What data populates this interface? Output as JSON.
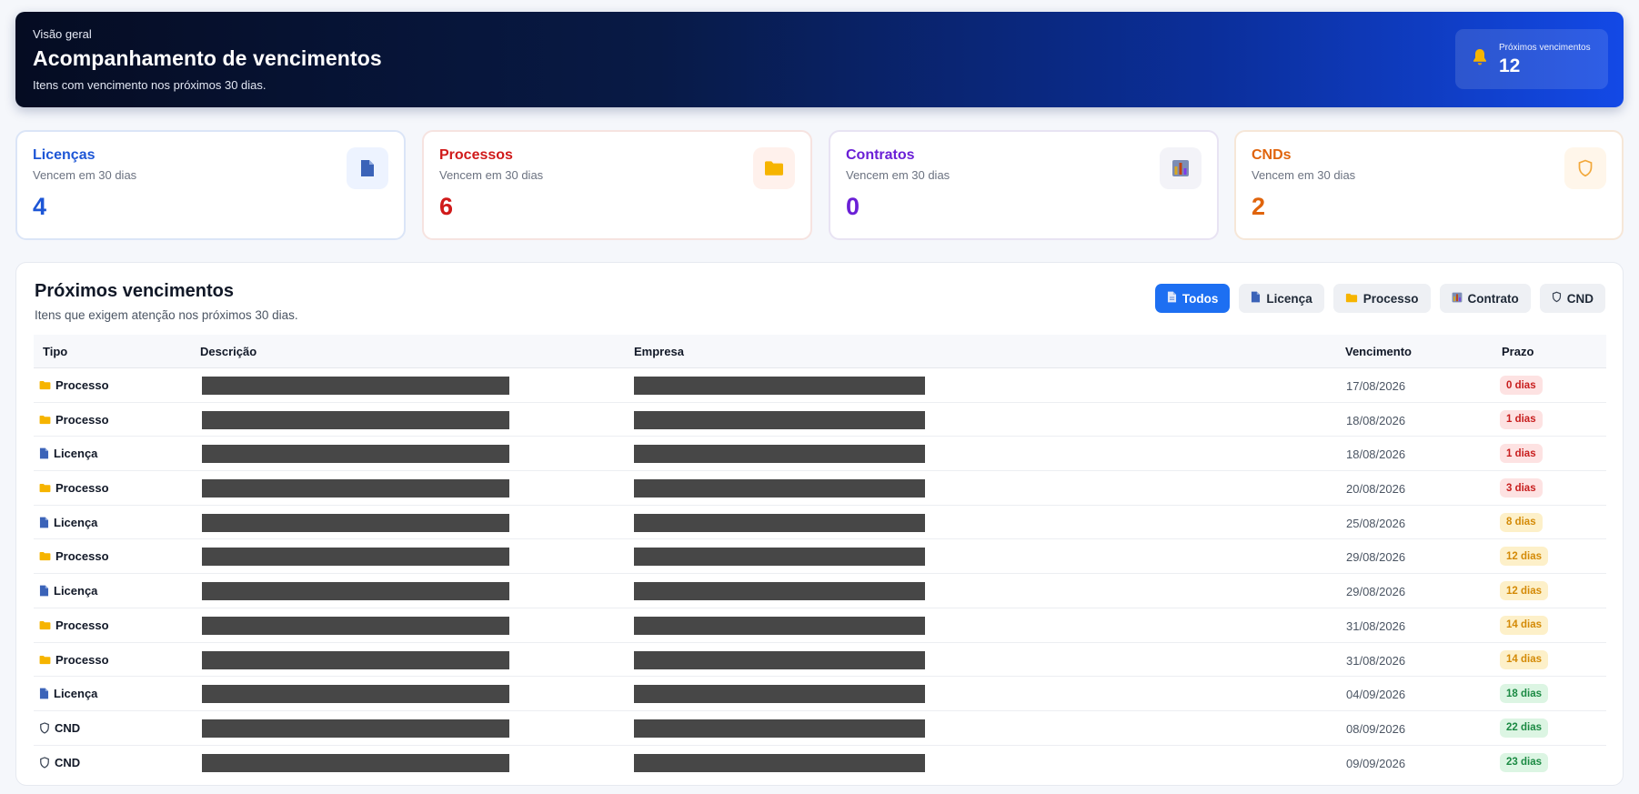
{
  "hero": {
    "eyebrow": "Visão geral",
    "title": "Acompanhamento de vencimentos",
    "subtitle": "Itens com vencimento nos próximos 30 dias.",
    "counter_label": "Próximos vencimentos",
    "counter_value": "12"
  },
  "cards": {
    "licencas": {
      "title": "Licenças",
      "subtitle": "Vencem em 30 dias",
      "value": "4",
      "icon": "document-icon"
    },
    "processos": {
      "title": "Processos",
      "subtitle": "Vencem em 30 dias",
      "value": "6",
      "icon": "folder-icon"
    },
    "contratos": {
      "title": "Contratos",
      "subtitle": "Vencem em 30 dias",
      "value": "0",
      "icon": "chart-icon"
    },
    "cnds": {
      "title": "CNDs",
      "subtitle": "Vencem em 30 dias",
      "value": "2",
      "icon": "shield-icon"
    }
  },
  "panel": {
    "title": "Próximos vencimentos",
    "subtitle": "Itens que exigem atenção nos próximos 30 dias."
  },
  "filters": [
    {
      "label": "Todos",
      "icon": "document-icon",
      "active": true
    },
    {
      "label": "Licença",
      "icon": "document-icon",
      "active": false
    },
    {
      "label": "Processo",
      "icon": "folder-icon",
      "active": false
    },
    {
      "label": "Contrato",
      "icon": "chart-icon",
      "active": false
    },
    {
      "label": "CND",
      "icon": "shield-icon",
      "active": false
    }
  ],
  "table": {
    "headers": {
      "tipo": "Tipo",
      "descricao": "Descrição",
      "empresa": "Empresa",
      "vencimento": "Vencimento",
      "prazo": "Prazo"
    },
    "rows": [
      {
        "tipo": "Processo",
        "vencimento": "17/08/2026",
        "prazo": "0 dias",
        "level": "red"
      },
      {
        "tipo": "Processo",
        "vencimento": "18/08/2026",
        "prazo": "1 dias",
        "level": "red"
      },
      {
        "tipo": "Licença",
        "vencimento": "18/08/2026",
        "prazo": "1 dias",
        "level": "red"
      },
      {
        "tipo": "Processo",
        "vencimento": "20/08/2026",
        "prazo": "3 dias",
        "level": "red"
      },
      {
        "tipo": "Licença",
        "vencimento": "25/08/2026",
        "prazo": "8 dias",
        "level": "amber"
      },
      {
        "tipo": "Processo",
        "vencimento": "29/08/2026",
        "prazo": "12 dias",
        "level": "amber"
      },
      {
        "tipo": "Licença",
        "vencimento": "29/08/2026",
        "prazo": "12 dias",
        "level": "amber"
      },
      {
        "tipo": "Processo",
        "vencimento": "31/08/2026",
        "prazo": "14 dias",
        "level": "amber"
      },
      {
        "tipo": "Processo",
        "vencimento": "31/08/2026",
        "prazo": "14 dias",
        "level": "amber"
      },
      {
        "tipo": "Licença",
        "vencimento": "04/09/2026",
        "prazo": "18 dias",
        "level": "green"
      },
      {
        "tipo": "CND",
        "vencimento": "08/09/2026",
        "prazo": "22 dias",
        "level": "green"
      },
      {
        "tipo": "CND",
        "vencimento": "09/09/2026",
        "prazo": "23 dias",
        "level": "green"
      }
    ]
  },
  "colors": {
    "primary": "#1d6ff2",
    "licenca": "#1d56d6",
    "processo": "#d01a1a",
    "contrato": "#6a1fd6",
    "cnd": "#e0640c",
    "folder": "#f6b400",
    "doc": "#3b63b8"
  }
}
